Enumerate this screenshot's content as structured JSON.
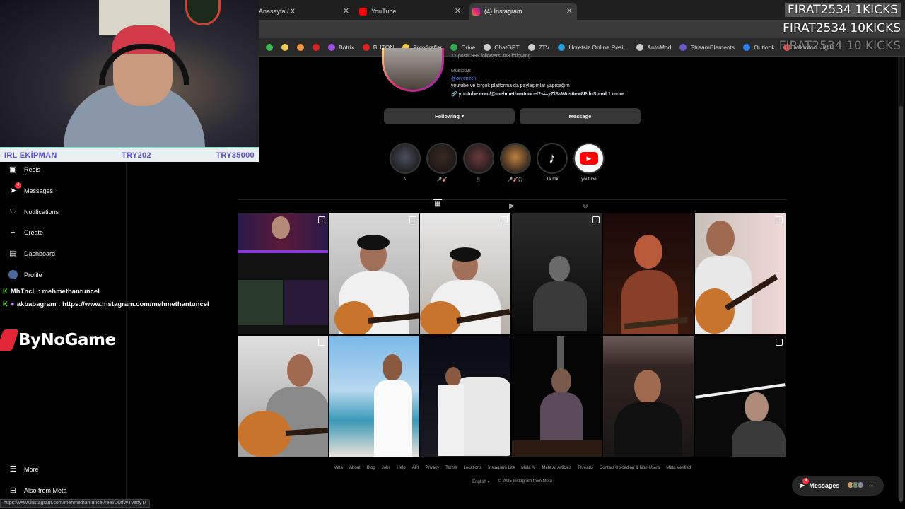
{
  "browser": {
    "tabs": [
      {
        "label": "Anasayfa / X",
        "icon": "x-logo-icon",
        "color": "#ffffff"
      },
      {
        "label": "YouTube",
        "icon": "youtube-icon",
        "color": "#ff0000"
      },
      {
        "label": "(4) Instagram",
        "icon": "instagram-icon",
        "color": "#e1306c"
      }
    ],
    "bookmarks": [
      {
        "label": "",
        "icon": "bookmark-icon-green",
        "color": "#3fb950"
      },
      {
        "label": "",
        "icon": "bookmark-icon-yellow",
        "color": "#f2c94c"
      },
      {
        "label": "",
        "icon": "bookmark-icon-orange",
        "color": "#f2994a"
      },
      {
        "label": "",
        "icon": "opera-icon",
        "color": "#e02020"
      },
      {
        "label": "Botrix",
        "icon": "botrix-icon",
        "color": "#9b51e0"
      },
      {
        "label": "BUTON",
        "icon": "buton-icon",
        "color": "#e02020"
      },
      {
        "label": "Fotoğraflar",
        "icon": "photos-icon",
        "color": "#f2c94c"
      },
      {
        "label": "Drive",
        "icon": "drive-icon",
        "color": "#34a853"
      },
      {
        "label": "ChatGPT",
        "icon": "chatgpt-icon",
        "color": "#cccccc"
      },
      {
        "label": "7TV",
        "icon": "7tv-icon",
        "color": "#cccccc"
      },
      {
        "label": "Ücretsiz Online Resi...",
        "icon": "rp-icon",
        "color": "#2d9cdb"
      },
      {
        "label": "AutoMod",
        "icon": "automod-icon",
        "color": "#cccccc"
      },
      {
        "label": "StreamElements",
        "icon": "streamelements-icon",
        "color": "#6a5acd"
      },
      {
        "label": "Outlook",
        "icon": "outlook-icon",
        "color": "#2f80ed"
      },
      {
        "label": "Mikrofon Hiçlik...",
        "icon": "mic-icon",
        "color": "#eb5757"
      }
    ]
  },
  "overlay": {
    "ekipman_label": "IRL EKİPMAN",
    "ekipman_current": "TRY202",
    "ekipman_goal": "TRY35000",
    "kicks": [
      "FIRAT2534 1KICKS",
      "FIRAT2534 10KICKS",
      "FIRAT2534 10 KICKS"
    ],
    "chat": [
      {
        "user": "MhTncL",
        "message": "mehmethantuncel"
      },
      {
        "user": "akbabagram",
        "message": "https://www.instagram.com/mehmethantuncel"
      }
    ],
    "sponsor": "ByNoGame"
  },
  "sidebar": {
    "items": [
      {
        "label": "Reels",
        "icon": "reels-icon"
      },
      {
        "label": "Messages",
        "icon": "messages-icon",
        "badge": "4"
      },
      {
        "label": "Notifications",
        "icon": "heart-icon"
      },
      {
        "label": "Create",
        "icon": "plus-icon"
      },
      {
        "label": "Dashboard",
        "icon": "dashboard-icon"
      },
      {
        "label": "Profile",
        "icon": "profile-avatar-icon"
      }
    ],
    "more": "More",
    "meta": "Also from Meta"
  },
  "profile": {
    "stats": "12 posts    998 followers    383 following",
    "category": "Musician",
    "handle": "@onrcnzcn",
    "bio": "youtube ve birçok platforma da paylaşımlar yapıcağım",
    "link": "youtube.com/@mehmethantuncel?si=yZlSsWns6ew8PdnS and 1 more",
    "following_button": "Following",
    "message_button": "Message"
  },
  "highlights": [
    {
      "label": "\\",
      "color": "#4a4f5a"
    },
    {
      "label": "🎤🎸",
      "color": "#3a2a20"
    },
    {
      "label": "📱",
      "color": "#6a3a3a"
    },
    {
      "label": "🎤🎸🎧",
      "color": "#c08040"
    },
    {
      "label": "TikTok",
      "color": "#ffffff"
    },
    {
      "label": "youtube",
      "color": "#ffffff"
    }
  ],
  "footer": {
    "links": [
      "Meta",
      "About",
      "Blog",
      "Jobs",
      "Help",
      "API",
      "Privacy",
      "Terms",
      "Locations",
      "Instagram Lite",
      "Meta AI",
      "Meta AI Articles",
      "Threads",
      "Contact Uploading & Non-Users",
      "Meta Verified"
    ],
    "language": "English",
    "copyright": "© 2025 Instagram from Meta"
  },
  "messages_float": {
    "label": "Messages",
    "badge": "4"
  },
  "status_url": "https://www.instagram.com/mehmethantuncel/reel/DMfWTvetfyT/"
}
